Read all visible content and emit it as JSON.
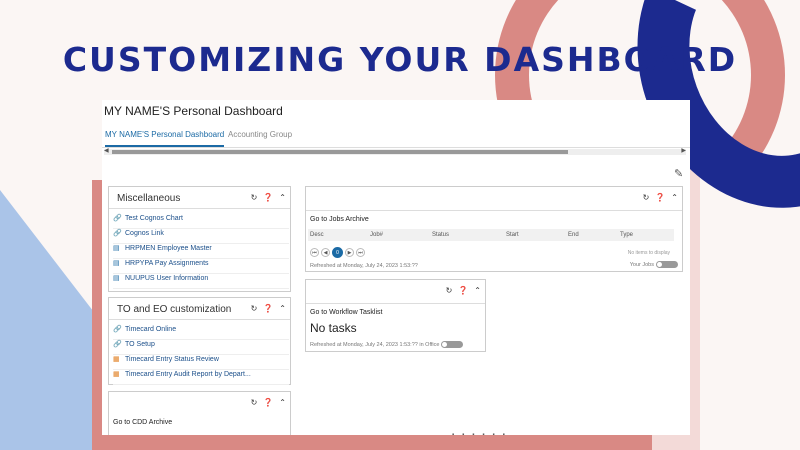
{
  "slide_title": "CUSTOMIZING  YOUR DASHBOARD",
  "dashboard": {
    "title": "MY NAME'S Personal Dashboard",
    "tabs": [
      "MY NAME'S Personal Dashboard",
      "Accounting Group"
    ],
    "edit_icon": "pencil-icon"
  },
  "misc_panel": {
    "title": "Miscellaneous",
    "items": [
      {
        "label": "Test Cognos Chart",
        "icon": "link-icon"
      },
      {
        "label": "Cognos Link",
        "icon": "link-icon"
      },
      {
        "label": "HRPMEN Employee Master",
        "icon": "screen-icon"
      },
      {
        "label": "HRPYPA Pay Assignments",
        "icon": "screen-icon"
      },
      {
        "label": "NUUPUS User Information",
        "icon": "screen-icon"
      }
    ]
  },
  "to_panel": {
    "title": "TO and EO customization",
    "items": [
      {
        "label": "Timecard Online",
        "icon": "link-icon"
      },
      {
        "label": "TO Setup",
        "icon": "link-icon"
      },
      {
        "label": "Timecard Entry Status Review",
        "icon": "report-icon"
      },
      {
        "label": "Timecard Entry Audit Report by Depart...",
        "icon": "report-icon"
      }
    ]
  },
  "cdd_panel": {
    "subtitle": "Go to CDD Archive"
  },
  "jobs_panel": {
    "subtitle": "Go to Jobs Archive",
    "columns": [
      "Desc",
      "Job#",
      "Status",
      "Start",
      "End",
      "Type"
    ],
    "current_page": "0",
    "empty_text": "No items to display",
    "footer": "Refreshed at Monday, July 24, 2023 1:53:??",
    "toggle_label": "Your Jobs"
  },
  "workflow_panel": {
    "subtitle": "Go to Workflow Tasklist",
    "status": "No tasks",
    "footer": "Refreshed at Monday, July 24, 2023 1:53:?? in Office"
  }
}
